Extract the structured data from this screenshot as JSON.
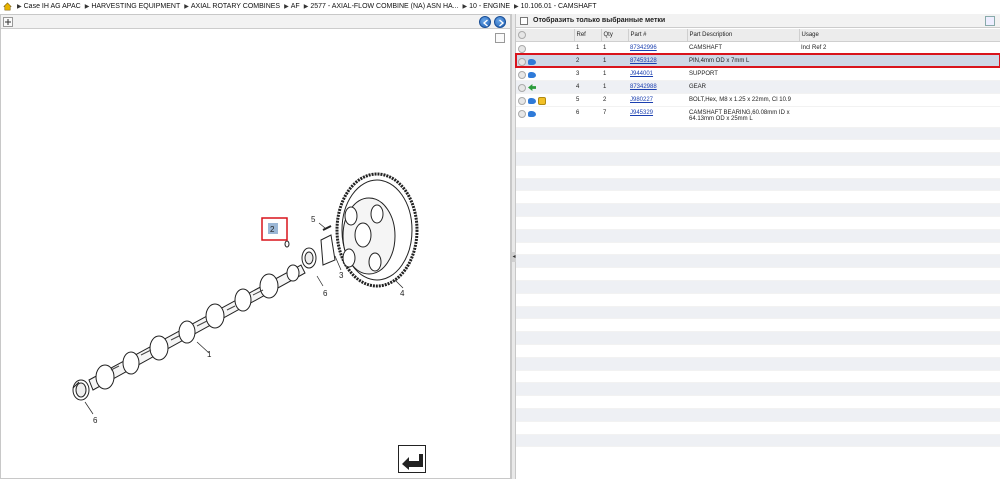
{
  "breadcrumb": {
    "items": [
      "Case IH AG APAC",
      "HARVESTING EQUIPMENT",
      "AXIAL ROTARY COMBINES",
      "AF",
      "2577 - AXIAL-FLOW COMBINE (NA) ASN HA...",
      "10 - ENGINE",
      "10.106.01 - CAMSHAFT"
    ]
  },
  "right_header": {
    "checkbox_label": "Отобразить только выбранные метки"
  },
  "table": {
    "headers": [
      "",
      "Ref",
      "Qty",
      "Part #",
      "Part Description",
      "Usage"
    ],
    "rows": [
      {
        "ref": "1",
        "qty": "1",
        "part": "87342996",
        "desc": "CAMSHAFT",
        "usage": "Incl Ref 2",
        "icons": [
          "info"
        ]
      },
      {
        "ref": "2",
        "qty": "1",
        "part": "87453128",
        "desc": "PIN,4mm OD x 7mm L",
        "usage": "",
        "icons": [
          "info",
          "blue"
        ]
      },
      {
        "ref": "3",
        "qty": "1",
        "part": "J944001",
        "desc": "SUPPORT",
        "usage": "",
        "icons": [
          "info",
          "blue"
        ]
      },
      {
        "ref": "4",
        "qty": "1",
        "part": "87342988",
        "desc": "GEAR",
        "usage": "",
        "icons": [
          "info",
          "green"
        ]
      },
      {
        "ref": "5",
        "qty": "2",
        "part": "J980227",
        "desc": "BOLT,Hex, M8 x 1.25 x 22mm, Cl 10.9",
        "usage": "",
        "icons": [
          "info",
          "blue",
          "yellow"
        ]
      },
      {
        "ref": "6",
        "qty": "7",
        "part": "J945329",
        "desc": "CAMSHAFT BEARING,60.08mm ID x",
        "desc2": "64.13mm OD x 25mm L",
        "usage": "",
        "icons": [
          "info",
          "blue"
        ]
      }
    ]
  },
  "diagram": {
    "callouts": [
      "1",
      "2",
      "3",
      "4",
      "5",
      "6",
      "6"
    ],
    "selected_callout": "2"
  },
  "colors": {
    "selection_outline": "#d9141c",
    "link": "#1a3fb0",
    "selected_row": "#cfd8e6"
  }
}
